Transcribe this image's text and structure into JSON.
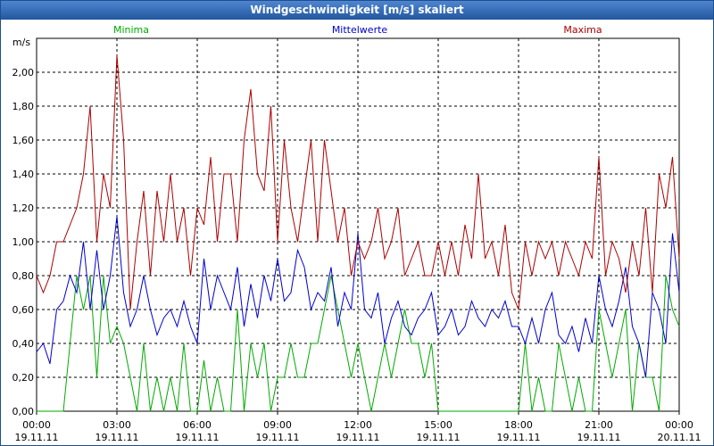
{
  "window": {
    "title": "Windgeschwindigkeit [m/s] skaliert"
  },
  "chart_data": {
    "type": "line",
    "title": "Windgeschwindigkeit [m/s] skaliert",
    "ylabel": "m/s",
    "ylim": [
      0,
      2.2
    ],
    "yticks": [
      "0,00",
      "0,20",
      "0,40",
      "0,60",
      "0,80",
      "1,00",
      "1,20",
      "1,40",
      "1,60",
      "1,80",
      "2,00"
    ],
    "xlim": [
      0,
      24
    ],
    "xticks": [
      {
        "time": "00:00",
        "date": "19.11.11"
      },
      {
        "time": "03:00",
        "date": "19.11.11"
      },
      {
        "time": "06:00",
        "date": "19.11.11"
      },
      {
        "time": "09:00",
        "date": "19.11.11"
      },
      {
        "time": "12:00",
        "date": "19.11.11"
      },
      {
        "time": "15:00",
        "date": "19.11.11"
      },
      {
        "time": "18:00",
        "date": "19.11.11"
      },
      {
        "time": "21:00",
        "date": "19.11.11"
      },
      {
        "time": "00:00",
        "date": "20.11.11"
      }
    ],
    "grid": true,
    "series": [
      {
        "name": "Minima",
        "color": "#00aa00",
        "x": [
          0,
          0.25,
          0.5,
          0.75,
          1.0,
          1.25,
          1.5,
          1.75,
          2.0,
          2.25,
          2.5,
          2.75,
          3.0,
          3.25,
          3.5,
          3.75,
          4.0,
          4.25,
          4.5,
          4.75,
          5.0,
          5.25,
          5.5,
          5.75,
          6.0,
          6.25,
          6.5,
          6.75,
          7.0,
          7.25,
          7.5,
          7.75,
          8.0,
          8.25,
          8.5,
          8.75,
          9.0,
          9.25,
          9.5,
          9.75,
          10.0,
          10.25,
          10.5,
          10.75,
          11.0,
          11.25,
          11.5,
          11.75,
          12.0,
          12.25,
          12.5,
          12.75,
          13.0,
          13.25,
          13.5,
          13.75,
          14.0,
          14.25,
          14.5,
          14.75,
          15.0,
          15.25,
          15.5,
          15.75,
          16.0,
          16.25,
          16.5,
          16.75,
          17.0,
          17.25,
          17.5,
          17.75,
          18.0,
          18.25,
          18.5,
          18.75,
          19.0,
          19.25,
          19.5,
          19.75,
          20.0,
          20.25,
          20.5,
          20.75,
          21.0,
          21.25,
          21.5,
          21.75,
          22.0,
          22.25,
          22.5,
          22.75,
          23.0,
          23.25,
          23.5,
          23.75,
          24.0
        ],
        "values": [
          0,
          0,
          0,
          0,
          0,
          0.4,
          0.8,
          0.6,
          0.8,
          0.2,
          0.8,
          0.4,
          0.5,
          0.4,
          0.2,
          0,
          0.4,
          0,
          0.2,
          0,
          0.2,
          0,
          0.4,
          0,
          0,
          0.3,
          0,
          0.2,
          0,
          0,
          0.6,
          0,
          0.4,
          0.2,
          0.4,
          0,
          0.2,
          0.2,
          0.4,
          0.2,
          0.2,
          0.4,
          0.4,
          0.6,
          0.8,
          0.6,
          0.4,
          0.2,
          0.4,
          0.2,
          0,
          0.2,
          0.4,
          0.2,
          0.4,
          0.6,
          0.4,
          0.4,
          0.2,
          0.4,
          0,
          0,
          0,
          0,
          0,
          0,
          0,
          0,
          0,
          0,
          0,
          0,
          0,
          0.4,
          0,
          0.2,
          0,
          0,
          0.4,
          0.2,
          0,
          0.2,
          0,
          0,
          0.6,
          0.4,
          0.2,
          0.4,
          0.6,
          0,
          0.4,
          0.2,
          0.2,
          0,
          0.8,
          0.6,
          0.5
        ]
      },
      {
        "name": "Mittelwerte",
        "color": "#0000cc",
        "x": [
          0,
          0.25,
          0.5,
          0.75,
          1.0,
          1.25,
          1.5,
          1.75,
          2.0,
          2.25,
          2.5,
          2.75,
          3.0,
          3.25,
          3.5,
          3.75,
          4.0,
          4.25,
          4.5,
          4.75,
          5.0,
          5.25,
          5.5,
          5.75,
          6.0,
          6.25,
          6.5,
          6.75,
          7.0,
          7.25,
          7.5,
          7.75,
          8.0,
          8.25,
          8.5,
          8.75,
          9.0,
          9.25,
          9.5,
          9.75,
          10.0,
          10.25,
          10.5,
          10.75,
          11.0,
          11.25,
          11.5,
          11.75,
          12.0,
          12.25,
          12.5,
          12.75,
          13.0,
          13.25,
          13.5,
          13.75,
          14.0,
          14.25,
          14.5,
          14.75,
          15.0,
          15.25,
          15.5,
          15.75,
          16.0,
          16.25,
          16.5,
          16.75,
          17.0,
          17.25,
          17.5,
          17.75,
          18.0,
          18.25,
          18.5,
          18.75,
          19.0,
          19.25,
          19.5,
          19.75,
          20.0,
          20.25,
          20.5,
          20.75,
          21.0,
          21.25,
          21.5,
          21.75,
          22.0,
          22.25,
          22.5,
          22.75,
          23.0,
          23.25,
          23.5,
          23.75,
          24.0
        ],
        "values": [
          0.35,
          0.4,
          0.28,
          0.6,
          0.65,
          0.8,
          0.7,
          1.0,
          0.6,
          0.95,
          0.6,
          0.8,
          1.15,
          0.7,
          0.5,
          0.6,
          0.8,
          0.6,
          0.45,
          0.55,
          0.6,
          0.5,
          0.65,
          0.5,
          0.4,
          0.9,
          0.6,
          0.8,
          0.7,
          0.6,
          0.85,
          0.5,
          0.75,
          0.55,
          0.8,
          0.65,
          0.9,
          0.65,
          0.7,
          0.95,
          0.85,
          0.6,
          0.7,
          0.65,
          0.85,
          0.5,
          0.7,
          0.6,
          1.05,
          0.6,
          0.55,
          0.7,
          0.4,
          0.55,
          0.65,
          0.5,
          0.45,
          0.55,
          0.6,
          0.7,
          0.45,
          0.5,
          0.6,
          0.45,
          0.5,
          0.65,
          0.55,
          0.5,
          0.6,
          0.55,
          0.65,
          0.5,
          0.5,
          0.4,
          0.55,
          0.4,
          0.6,
          0.7,
          0.45,
          0.4,
          0.5,
          0.35,
          0.55,
          0.4,
          0.8,
          0.6,
          0.5,
          0.65,
          0.85,
          0.5,
          0.4,
          0.2,
          0.7,
          0.6,
          0.4,
          1.05,
          0.7
        ]
      },
      {
        "name": "Maxima",
        "color": "#aa0000",
        "x": [
          0,
          0.25,
          0.5,
          0.75,
          1.0,
          1.25,
          1.5,
          1.75,
          2.0,
          2.25,
          2.5,
          2.75,
          3.0,
          3.25,
          3.5,
          3.75,
          4.0,
          4.25,
          4.5,
          4.75,
          5.0,
          5.25,
          5.5,
          5.75,
          6.0,
          6.25,
          6.5,
          6.75,
          7.0,
          7.25,
          7.5,
          7.75,
          8.0,
          8.25,
          8.5,
          8.75,
          9.0,
          9.25,
          9.5,
          9.75,
          10.0,
          10.25,
          10.5,
          10.75,
          11.0,
          11.25,
          11.5,
          11.75,
          12.0,
          12.25,
          12.5,
          12.75,
          13.0,
          13.25,
          13.5,
          13.75,
          14.0,
          14.25,
          14.5,
          14.75,
          15.0,
          15.25,
          15.5,
          15.75,
          16.0,
          16.25,
          16.5,
          16.75,
          17.0,
          17.25,
          17.5,
          17.75,
          18.0,
          18.25,
          18.5,
          18.75,
          19.0,
          19.25,
          19.5,
          19.75,
          20.0,
          20.25,
          20.5,
          20.75,
          21.0,
          21.25,
          21.5,
          21.75,
          22.0,
          22.25,
          22.5,
          22.75,
          23.0,
          23.25,
          23.5,
          23.75,
          24.0
        ],
        "values": [
          0.8,
          0.7,
          0.8,
          1.0,
          1.0,
          1.1,
          1.2,
          1.4,
          1.8,
          1.0,
          1.4,
          1.2,
          2.1,
          1.6,
          0.6,
          1.0,
          1.3,
          0.8,
          1.3,
          1.0,
          1.4,
          1.0,
          1.2,
          0.8,
          1.2,
          1.1,
          1.5,
          1.0,
          1.4,
          1.4,
          1.0,
          1.6,
          1.9,
          1.4,
          1.3,
          1.8,
          1.0,
          1.6,
          1.2,
          1.0,
          1.3,
          1.6,
          1.0,
          1.6,
          1.3,
          1.0,
          1.2,
          0.8,
          1.0,
          0.9,
          1.0,
          1.2,
          0.9,
          1.0,
          1.2,
          0.8,
          0.9,
          1.0,
          0.8,
          0.8,
          1.0,
          0.8,
          1.0,
          0.8,
          1.1,
          0.9,
          1.4,
          0.9,
          1.0,
          0.8,
          1.1,
          0.7,
          0.6,
          1.0,
          0.8,
          1.0,
          0.9,
          1.0,
          0.8,
          1.0,
          0.9,
          0.8,
          1.0,
          0.9,
          1.5,
          0.8,
          1.0,
          0.9,
          0.7,
          1.0,
          0.8,
          1.2,
          0.7,
          1.4,
          1.2,
          1.5,
          0.9
        ]
      }
    ]
  }
}
